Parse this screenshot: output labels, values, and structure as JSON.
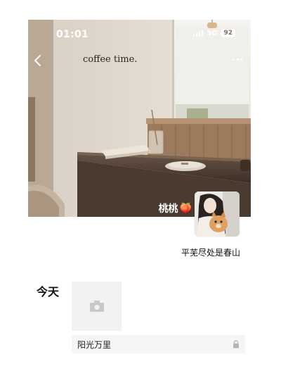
{
  "status_bar": {
    "time": "01:01",
    "network": "5G",
    "battery": "92"
  },
  "cover": {
    "caption": "coffee time."
  },
  "profile": {
    "username": "桃桃",
    "username_emoji": "🍑",
    "signature": "平芜尽处是春山"
  },
  "feed": {
    "day_label": "今天",
    "post_text": "阳光万里"
  },
  "icons": {
    "back": "chevron-left-icon",
    "more": "more-dots-icon",
    "camera": "camera-icon",
    "lock": "lock-icon"
  },
  "colors": {
    "placeholder_bg": "#f2f2f2",
    "post_row_bg": "#f5f5f5",
    "text": "#111111"
  }
}
